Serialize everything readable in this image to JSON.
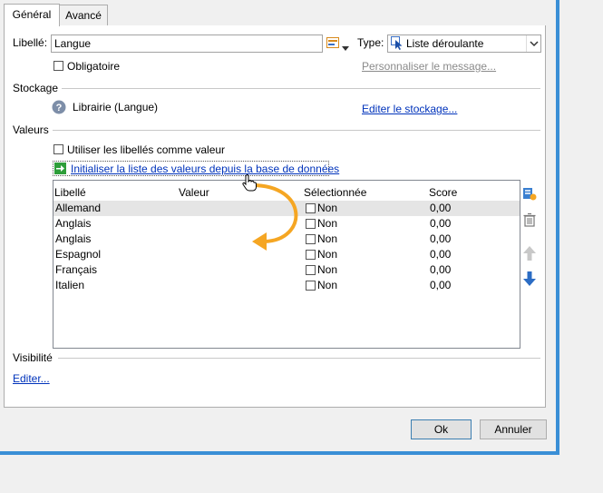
{
  "tabs": [
    "Général",
    "Avancé"
  ],
  "labels": {
    "libelle": "Libellé:",
    "type": "Type:",
    "stockage": "Stockage",
    "valeurs": "Valeurs",
    "visibilite": "Visibilité"
  },
  "libelle_value": "Langue",
  "type_value": "Liste déroulante",
  "obligatoire": "Obligatoire",
  "personnaliser": "Personnaliser le message...",
  "storage_text": "Librairie (Langue)",
  "edit_storage": "Editer le stockage...",
  "use_labels": "Utiliser les libellés comme valeur",
  "init_link": "Initialiser la liste des valeurs depuis la base de données",
  "table": {
    "headers": [
      "Libellé",
      "Valeur",
      "Sélectionnée",
      "Score"
    ],
    "rows": [
      {
        "libelle": "Allemand",
        "valeur": "",
        "selection": "Non",
        "score": "0,00"
      },
      {
        "libelle": "Anglais",
        "valeur": "",
        "selection": "Non",
        "score": "0,00"
      },
      {
        "libelle": "Anglais",
        "valeur": "",
        "selection": "Non",
        "score": "0,00"
      },
      {
        "libelle": "Espagnol",
        "valeur": "",
        "selection": "Non",
        "score": "0,00"
      },
      {
        "libelle": "Français",
        "valeur": "",
        "selection": "Non",
        "score": "0,00"
      },
      {
        "libelle": "Italien",
        "valeur": "",
        "selection": "Non",
        "score": "0,00"
      }
    ]
  },
  "edit_visibility": "Editer...",
  "buttons": {
    "ok": "Ok",
    "cancel": "Annuler"
  },
  "colors": {
    "accent": "#3a8fd6",
    "link": "#0033bb",
    "arrow": "#f5a623",
    "green": "#2e9e3a"
  }
}
